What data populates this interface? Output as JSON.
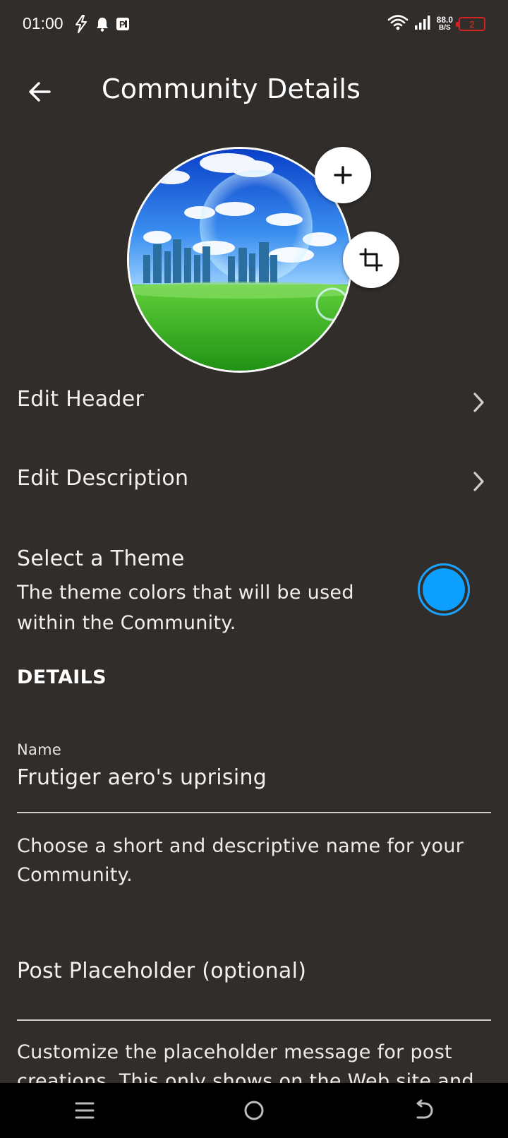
{
  "status_bar": {
    "time": "01:00",
    "net_speed_value": "88.0",
    "net_speed_unit": "B/S",
    "battery_level": "2",
    "left_icons": [
      "flash-icon",
      "notification-bell-icon",
      "parking-icon"
    ],
    "right_icons": [
      "wifi-icon",
      "signal-icon",
      "battery-icon"
    ]
  },
  "app_bar": {
    "title": "Community Details"
  },
  "menu": {
    "edit_header": "Edit Header",
    "edit_description": "Edit Description"
  },
  "theme": {
    "title": "Select a Theme",
    "description": "The theme colors that will be used within the Community.",
    "color": "#0ea0ff"
  },
  "details": {
    "section_title": "DETAILS",
    "name_label": "Name",
    "name_value": "Frutiger aero's uprising",
    "name_helper": "Choose a short and descriptive name for your Community.",
    "post_placeholder_label": "Post Placeholder (optional)",
    "post_placeholder_helper": "Customize the placeholder message for post creations. This only shows on the Web site and"
  },
  "nav": {
    "icons": [
      "menu-icon",
      "home-icon",
      "back-icon"
    ]
  }
}
